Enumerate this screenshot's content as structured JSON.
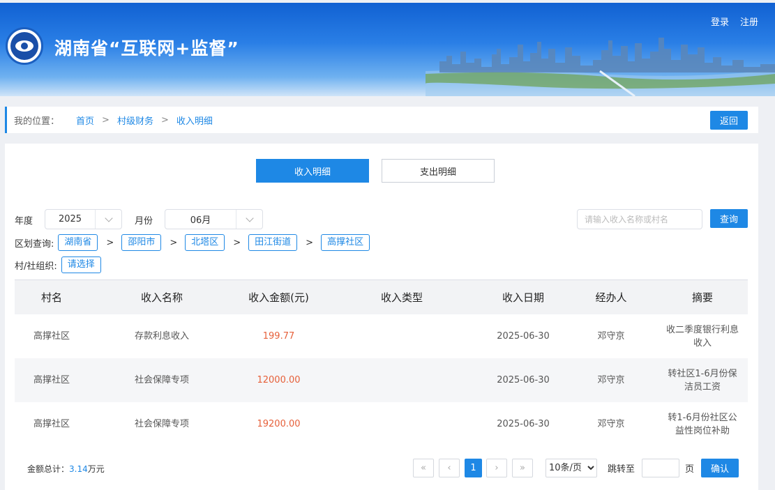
{
  "header": {
    "site_title": "湖南省“互联网+监督”",
    "login": "登录",
    "register": "注册"
  },
  "breadcrumb": {
    "label": "我的位置：",
    "items": [
      "首页",
      "村级财务",
      "收入明细"
    ],
    "separator": ">",
    "back": "返回"
  },
  "tabs": [
    {
      "label": "收入明细",
      "active": true
    },
    {
      "label": "支出明细",
      "active": false
    }
  ],
  "filters": {
    "year_label": "年度",
    "year_value": "2025",
    "month_label": "月份",
    "month_value": "06月",
    "search_placeholder": "请输入收入名称或村名",
    "query_button": "查询",
    "region_label": "区划查询:",
    "regions": [
      "湖南省",
      "邵阳市",
      "北塔区",
      "田江街道",
      "高撑社区"
    ],
    "org_label": "村/社组织:",
    "org_value": "请选择"
  },
  "table": {
    "columns": [
      "村名",
      "收入名称",
      "收入金额(元)",
      "收入类型",
      "收入日期",
      "经办人",
      "摘要"
    ],
    "rows": [
      {
        "village": "高撑社区",
        "name": "存款利息收入",
        "amount": "199.77",
        "type": "",
        "date": "2025-06-30",
        "handler": "邓守京",
        "summary": "收二季度银行利息收入"
      },
      {
        "village": "高撑社区",
        "name": "社会保障专项",
        "amount": "12000.00",
        "type": "",
        "date": "2025-06-30",
        "handler": "邓守京",
        "summary": "转社区1-6月份保洁员工资"
      },
      {
        "village": "高撑社区",
        "name": "社会保障专项",
        "amount": "19200.00",
        "type": "",
        "date": "2025-06-30",
        "handler": "邓守京",
        "summary": "转1-6月份社区公益性岗位补助"
      }
    ]
  },
  "footer": {
    "total_label": "金额总计：",
    "total_value": "3.14",
    "total_unit": "万元"
  },
  "pagination": {
    "first": "«",
    "prev": "‹",
    "current": "1",
    "next": "›",
    "last": "»",
    "per_page": "10条/页",
    "goto_label": "跳转至",
    "page_label": "页",
    "confirm": "确认"
  },
  "colors": {
    "primary": "#1e88e5",
    "amount": "#e6603a",
    "banner_top": "#0f5fd1"
  }
}
